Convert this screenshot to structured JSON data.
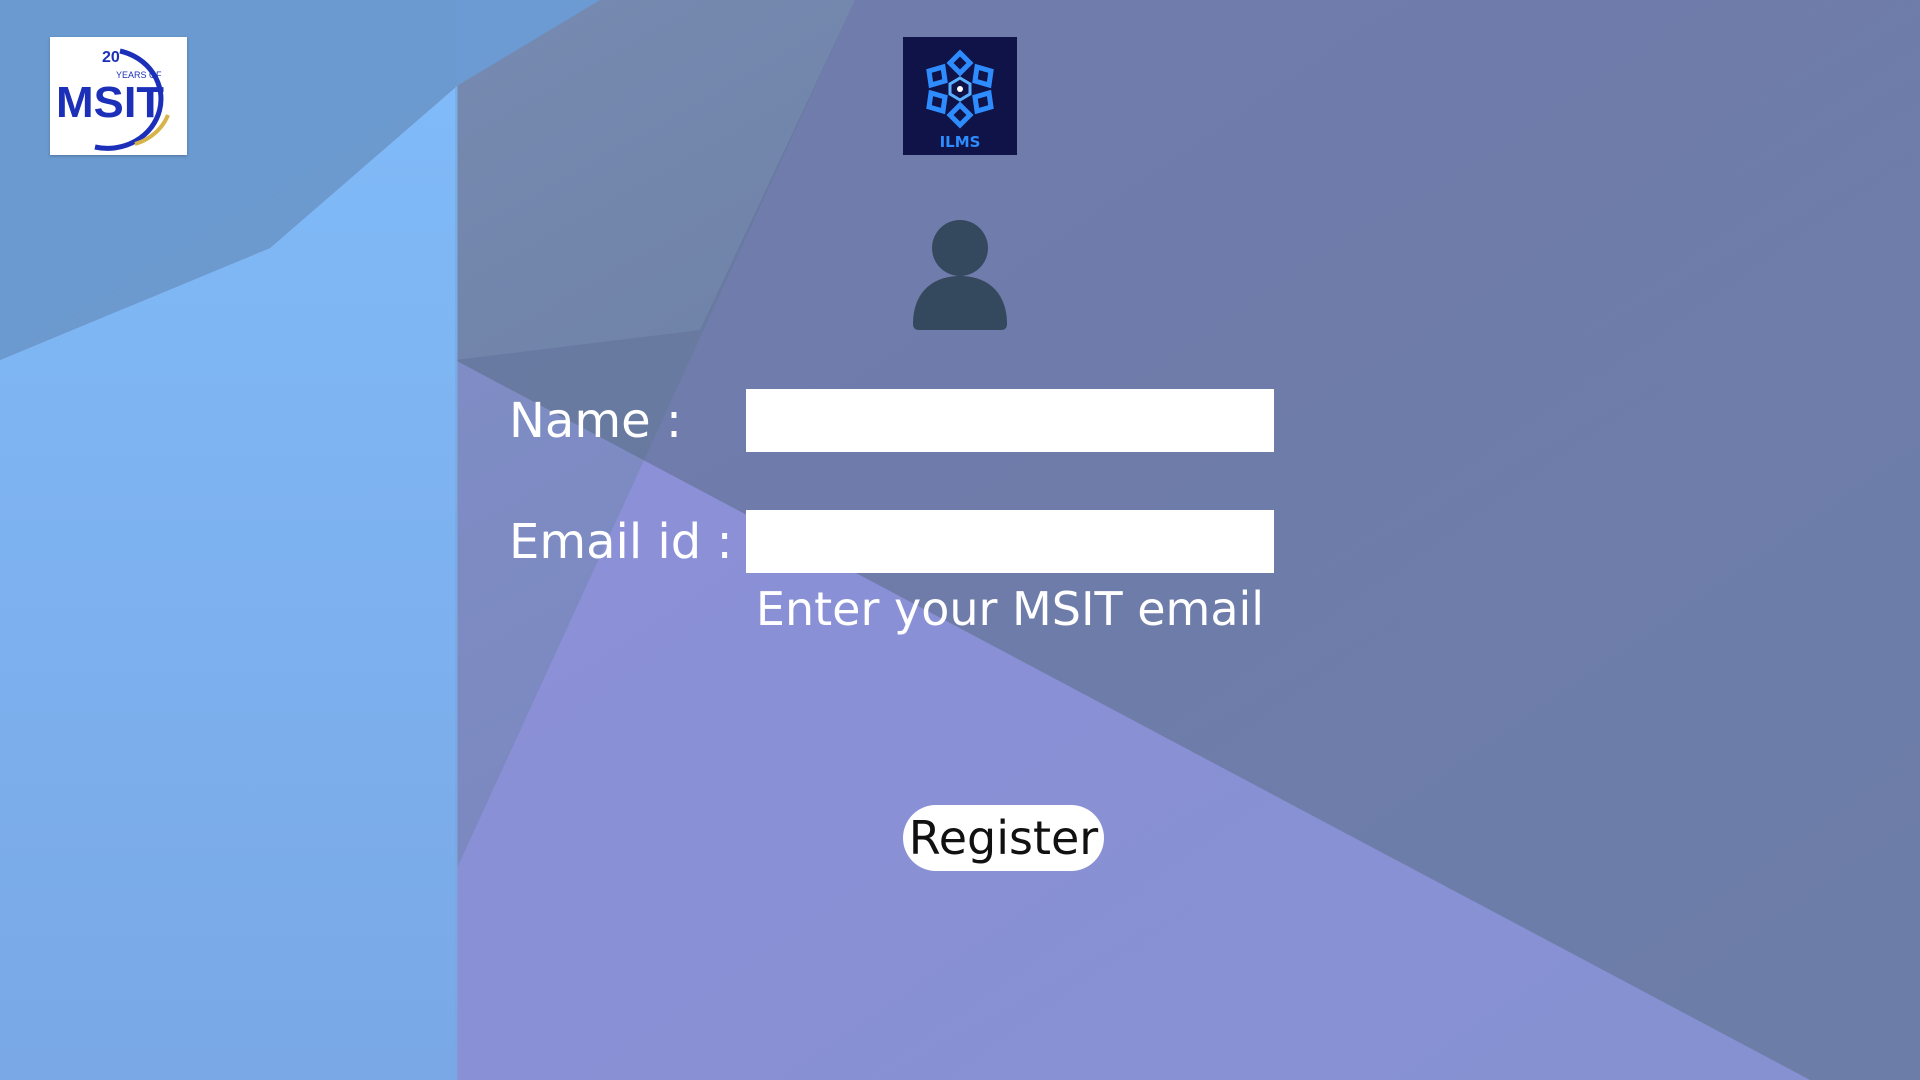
{
  "branding": {
    "msit_logo": {
      "icon": "msit-20-years-logo",
      "years_number": "20",
      "years_text": "YEARS OF",
      "wordmark": "MSIT"
    },
    "ilms_logo": {
      "icon": "ilms-snowflake-logo",
      "wordmark": "ILMS"
    }
  },
  "avatar": {
    "icon": "user-silhouette-icon",
    "color": "#34495e"
  },
  "form": {
    "name_label": "Name :",
    "name_value": "",
    "email_label": "Email id :",
    "email_value": "",
    "email_hint": "Enter your MSIT email",
    "register_label": "Register"
  },
  "colors": {
    "light_blue_panel": "#7fb3f2",
    "purple_band": "#9a8ce0",
    "slate_background": "#66789c",
    "avatar": "#34495e",
    "ilms_logo_background": "#0f1347",
    "ilms_logo_accent": "#2e8cff",
    "msit_logo_blue": "#1b2fb8",
    "msit_logo_gold": "#d6b44a"
  }
}
